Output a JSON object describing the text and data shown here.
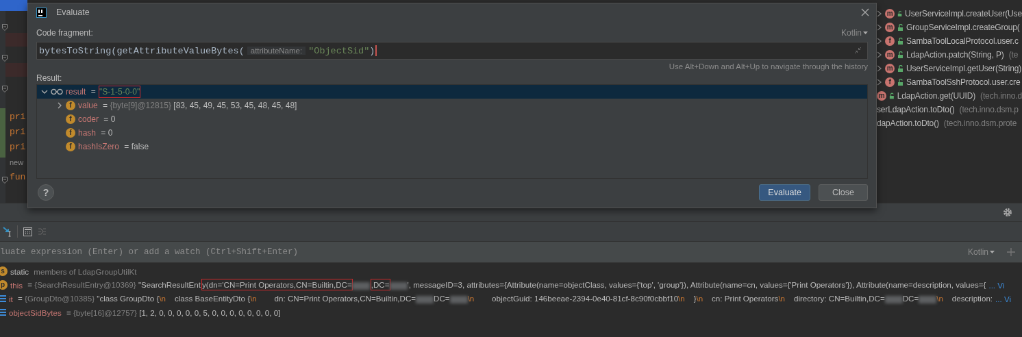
{
  "editor": {
    "lines": [
      {
        "kind": "keyword",
        "text": "pri"
      },
      {
        "kind": "keyword",
        "text": "pri"
      },
      {
        "kind": "keyword",
        "text": "pri"
      },
      {
        "kind": "hint",
        "text": "new"
      },
      {
        "kind": "keyword",
        "text": "fun"
      }
    ]
  },
  "call_hierarchy": [
    {
      "kind": "method",
      "badge": "m",
      "expandable": true,
      "text": "UserServiceImpl.createUser(Use"
    },
    {
      "kind": "method",
      "badge": "m",
      "expandable": true,
      "text": "GroupServiceImpl.createGroup("
    },
    {
      "kind": "function",
      "badge": "f",
      "expandable": true,
      "text": "SambaToolLocalProtocol.user.c"
    },
    {
      "kind": "method",
      "badge": "m",
      "expandable": true,
      "text": "LdapAction.patch(String, P)",
      "detail": "(te"
    },
    {
      "kind": "method",
      "badge": "m",
      "expandable": true,
      "text": "UserServiceImpl.getUser(String)"
    },
    {
      "kind": "function",
      "badge": "f",
      "expandable": true,
      "text": "SambaToolSshProtocol.user.cre"
    },
    {
      "kind": "method",
      "badge": "m",
      "expandable": false,
      "text": "LdapAction.get(UUID)",
      "detail": "(tech.inno.d"
    },
    {
      "kind": "plain",
      "expandable": false,
      "text": "serLdapAction.toDto()",
      "detail": "(tech.inno.dsm.p"
    },
    {
      "kind": "plain",
      "expandable": false,
      "text": "dapAction.toDto()",
      "detail": "(tech.inno.dsm.prote"
    }
  ],
  "dialog": {
    "title": "Evaluate",
    "label": "Code fragment:",
    "language": "Kotlin",
    "code": [
      {
        "kind": "code",
        "text": "bytesToString(getAttributeValueBytes("
      },
      {
        "kind": "hint",
        "text": "attributeName:"
      },
      {
        "kind": "string",
        "text": "\"ObjectSid\""
      },
      {
        "kind": "code",
        "text": ")"
      }
    ],
    "history_hint": "Use Alt+Down and Alt+Up to navigate through the history",
    "result_label": "Result:",
    "tree": [
      {
        "kind": "watch",
        "name": "result",
        "expanded": true,
        "selected": true,
        "segments": [
          {
            "kind": "plain",
            "text": " = "
          },
          {
            "kind": "string",
            "text": "\"S-1-5-0-0\"",
            "boxed": true
          }
        ],
        "children": [
          {
            "kind": "field",
            "badge": "f",
            "name": "value",
            "expanded": false,
            "selected": false,
            "segments": [
              {
                "kind": "plain",
                "text": " = "
              },
              {
                "kind": "muted",
                "text": "{byte[9]@12815} "
              },
              {
                "kind": "plain",
                "text": "[83, 45, 49, 45, 53, 45, 48, 45, 48]"
              }
            ]
          },
          {
            "kind": "field",
            "badge": "f",
            "name": "coder",
            "selected": false,
            "segments": [
              {
                "kind": "plain",
                "text": " = 0"
              }
            ]
          },
          {
            "kind": "field",
            "badge": "f",
            "name": "hash",
            "selected": false,
            "segments": [
              {
                "kind": "plain",
                "text": " = 0"
              }
            ]
          },
          {
            "kind": "field",
            "badge": "f",
            "name": "hashIsZero",
            "selected": false,
            "segments": [
              {
                "kind": "plain",
                "text": " = false"
              }
            ]
          }
        ]
      }
    ],
    "help": "?",
    "buttons": [
      {
        "label": "Evaluate",
        "default": true
      },
      {
        "label": "Close",
        "default": false
      }
    ]
  },
  "debugger": {
    "expression_placeholder": "luate expression (Enter) or add a watch (Ctrl+Shift+Enter)",
    "language": "Kotlin",
    "variables": [
      {
        "kind": "static",
        "badge": "s",
        "name": "static",
        "segments": [
          {
            "kind": "muted",
            "text": " members of LdapGroupUtilKt"
          }
        ]
      },
      {
        "kind": "parameter",
        "badge": "p",
        "name": "this",
        "segments": [
          {
            "kind": "plain",
            "text": " = "
          },
          {
            "kind": "muted",
            "text": "{SearchResultEntry@10369} "
          },
          {
            "kind": "plain",
            "text": "\"SearchResultEnt"
          },
          {
            "kind": "plain",
            "boxed": true,
            "text": "y(dn='CN=Print Operators,CN=Builtin,DC="
          },
          {
            "kind": "redacted"
          },
          {
            "kind": "plain",
            "boxed": true,
            "text": ",DC="
          },
          {
            "kind": "redacted"
          },
          {
            "kind": "plain",
            "text": "', messageID=3, attributes={Attribute(name=objectClass, values={'top', 'group'}), Attribute(name=cn, values={'Print Operators'}), Attribute(name=description, values={"
          }
        ],
        "link": "... Vi"
      },
      {
        "kind": "local",
        "name": "it",
        "segments": [
          {
            "kind": "plain",
            "text": " = "
          },
          {
            "kind": "muted",
            "text": "{GroupDto@10385} "
          },
          {
            "kind": "plain",
            "text": "\"class GroupDto {"
          },
          {
            "kind": "escape",
            "text": "\\n"
          },
          {
            "kind": "plain",
            "text": "    class BaseEntityDto {"
          },
          {
            "kind": "escape",
            "text": "\\n"
          },
          {
            "kind": "plain",
            "text": "        dn: CN=Print Operators,CN=Builtin,DC="
          },
          {
            "kind": "redacted"
          },
          {
            "kind": "plain",
            "text": "DC="
          },
          {
            "kind": "redacted"
          },
          {
            "kind": "escape",
            "text": "\\n"
          },
          {
            "kind": "plain",
            "text": "        objectGuid: 146beeae-2394-0e40-81cf-8c90f0cbbf10"
          },
          {
            "kind": "escape",
            "text": "\\n"
          },
          {
            "kind": "plain",
            "text": "    }"
          },
          {
            "kind": "escape",
            "text": "\\n"
          },
          {
            "kind": "plain",
            "text": "    cn: Print Operators"
          },
          {
            "kind": "escape",
            "text": "\\n"
          },
          {
            "kind": "plain",
            "text": "    directory: CN=Builtin,DC="
          },
          {
            "kind": "redacted"
          },
          {
            "kind": "plain",
            "text": "DC="
          },
          {
            "kind": "redacted"
          },
          {
            "kind": "escape",
            "text": "\\n"
          },
          {
            "kind": "plain",
            "text": "    description:"
          }
        ],
        "link": "... Vi"
      },
      {
        "kind": "local",
        "name": "objectSidBytes",
        "segments": [
          {
            "kind": "plain",
            "text": " = "
          },
          {
            "kind": "muted",
            "text": "{byte[16]@12757} "
          },
          {
            "kind": "plain",
            "text": "[1, 2, 0, 0, 0, 0, 0, 5, 0, 0, 0, 0, 0, 0, 0, 0]"
          }
        ]
      }
    ]
  }
}
